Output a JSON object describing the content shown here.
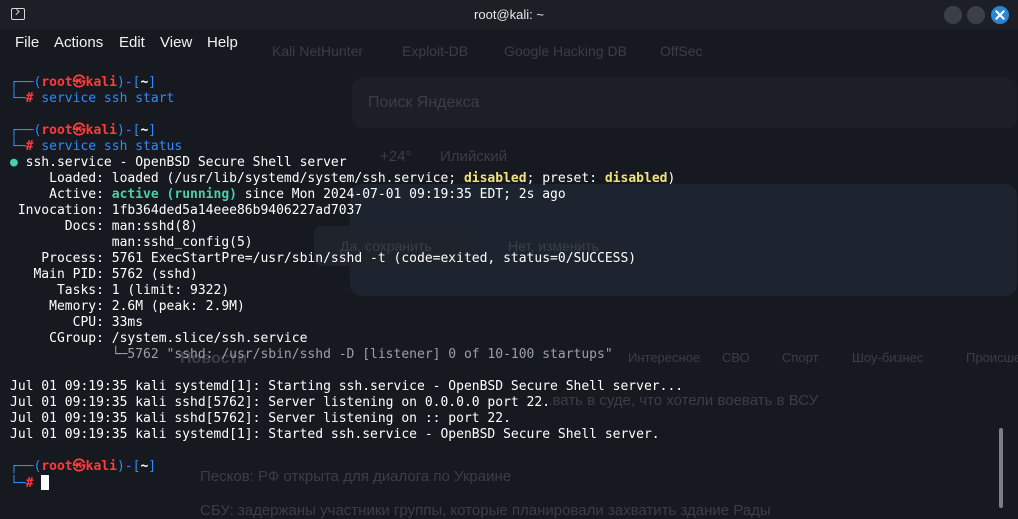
{
  "window": {
    "title": "root@kali: ~",
    "icon": "terminal-icon"
  },
  "menu": [
    "File",
    "Actions",
    "Edit",
    "View",
    "Help"
  ],
  "background_page": {
    "url": "https://dzen.ru/?yredirect=true",
    "bookmarks": [
      "Kali NetHunter",
      "Exploit-DB",
      "Google Hacking DB",
      "OffSec"
    ],
    "search_placeholder": "Поиск Яндекса",
    "weather": "+24°",
    "city": "Илийский",
    "save_button": "Да, сохранить",
    "change_button": "Нет, изменить",
    "news_title": "Новости",
    "news_tabs": [
      "Интересное",
      "СВО",
      "Спорт",
      "Шоу-бизнес",
      "Происшествия"
    ],
    "headline_1": "...вать в суде, что хотели воевать в ВСУ",
    "headline_2": "Песков: РФ открыта для диалога по Украине",
    "headline_3": "СБУ: задержаны участники группы, которые планировали захватить здание Рады"
  },
  "terminal": {
    "prompt": {
      "top_left": "┌──(",
      "user": "root",
      "at": "㉿",
      "host": "kali",
      "mid": ")-[",
      "dir": "~",
      "end": "]",
      "bottom": "└─",
      "hash": "#"
    },
    "cmd1": "service ssh start",
    "cmd2": "service ssh status",
    "status": {
      "header_dot": "●",
      "header": " ssh.service - OpenBSD Secure Shell server",
      "loaded_label": "     Loaded: ",
      "loaded_pre": "loaded (/usr/lib/systemd/system/ssh.service; ",
      "loaded_disabled": "disabled",
      "loaded_mid": "; preset: ",
      "loaded_preset": "disabled",
      "loaded_end": ")",
      "active_label": "     Active: ",
      "active_state": "active (running)",
      "active_rest": " since Mon 2024-07-01 09:19:35 EDT; 2s ago",
      "invocation": " Invocation: 1fb364ded5a14eee86b9406227ad7037",
      "docs1": "       Docs: man:sshd(8)",
      "docs2": "             man:sshd_config(5)",
      "process": "    Process: 5761 ExecStartPre=/usr/sbin/sshd -t (code=exited, status=0/SUCCESS)",
      "mainpid": "   Main PID: 5762 (sshd)",
      "tasks": "      Tasks: 1 (limit: 9322)",
      "memory": "     Memory: 2.6M (peak: 2.9M)",
      "cpu": "        CPU: 33ms",
      "cgroup": "     CGroup: /system.slice/ssh.service",
      "cgroup_child": "             └─5762 \"sshd: /usr/sbin/sshd -D [listener] 0 of 10-100 startups\""
    },
    "logs": [
      "Jul 01 09:19:35 kali systemd[1]: Starting ssh.service - OpenBSD Secure Shell server...",
      "Jul 01 09:19:35 kali sshd[5762]: Server listening on 0.0.0.0 port 22.",
      "Jul 01 09:19:35 kali sshd[5762]: Server listening on :: port 22.",
      "Jul 01 09:19:35 kali systemd[1]: Started ssh.service - OpenBSD Secure Shell server."
    ]
  },
  "colors": {
    "background": "#16191f",
    "prompt_blue": "#2a8cff",
    "prompt_red": "#ff3b3b",
    "active_green": "#48d0a8",
    "disabled_yellow": "#f1e37a",
    "close_button": "#2a86d4"
  }
}
